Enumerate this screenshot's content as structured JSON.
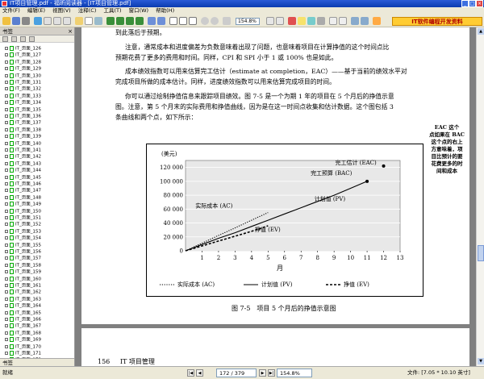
{
  "window": {
    "title": "IT项目管理.pdf - 福昕阅读器 - [IT项目管理.pdf]",
    "minimize": "_",
    "maximize": "□",
    "close": "×"
  },
  "menu": [
    "文件(F)",
    "编辑(E)",
    "视图(V)",
    "注释(C)",
    "工具(T)",
    "窗口(W)",
    "帮助(H)"
  ],
  "toolbar": {
    "zoom_value": "154.8%"
  },
  "ad_banner": "IT软件编程开发资料",
  "sidebar": {
    "title": "书签",
    "close_label": "×",
    "bookmarks": [
      "IT_页面_126",
      "IT_页面_127",
      "IT_页面_128",
      "IT_页面_129",
      "IT_页面_130",
      "IT_页面_131",
      "IT_页面_132",
      "IT_页面_133",
      "IT_页面_134",
      "IT_页面_135",
      "IT_页面_136",
      "IT_页面_137",
      "IT_页面_138",
      "IT_页面_139",
      "IT_页面_140",
      "IT_页面_141",
      "IT_页面_142",
      "IT_页面_143",
      "IT_页面_144",
      "IT_页面_145",
      "IT_页面_146",
      "IT_页面_147",
      "IT_页面_148",
      "IT_页面_149",
      "IT_页面_150",
      "IT_页面_151",
      "IT_页面_152",
      "IT_页面_153",
      "IT_页面_154",
      "IT_页面_155",
      "IT_页面_156",
      "IT_页面_157",
      "IT_页面_158",
      "IT_页面_159",
      "IT_页面_160",
      "IT_页面_161",
      "IT_页面_162",
      "IT_页面_163",
      "IT_页面_164",
      "IT_页面_165",
      "IT_页面_166",
      "IT_页面_167",
      "IT_页面_168",
      "IT_页面_169",
      "IT_页面_170",
      "IT_页面_171",
      "IT_页面_172"
    ],
    "footer": "书签"
  },
  "document": {
    "lines": [
      "到此落后于预期。",
      "注意，通常成本和进度偏差为负数意味着出现了问题，也意味着项目在计算挣值的这个时间点比",
      "预期花费了更多的费用和时间。同样，CPI 和 SPI 小于 1 或 100% 也是如此。",
      "成本绩效指数可以用来估算完工估计（estimate at completion，EAC）——基于当前的绩效水平对",
      "完成项目所做的成本估计。同样，进度绩效指数可以用来估算完成项目的时间。",
      "你可以通过绘制挣值信息来跟踪项目绩效。图 7-5 是一个为期 1 年的项目在 5 个月后的挣值示意",
      "图。注意，第 5 个月末的实际费用和挣值曲线，因为是在这一时间点收集和估计数据。这个图包括 3",
      "条曲线和两个点，如下所示："
    ],
    "caption": "图 7-5　项目 5 个月后的挣值示意图",
    "page_number": "156",
    "page_footer": "IT 项目管理"
  },
  "chart_data": {
    "type": "line",
    "ylabel": "(美元)",
    "xlabel": "月",
    "x": [
      0,
      1,
      2,
      3,
      4,
      5,
      6,
      7,
      8,
      9,
      10,
      11,
      12,
      13
    ],
    "xticks": [
      "1",
      "2",
      "3",
      "4",
      "5",
      "6",
      "7",
      "8",
      "9",
      "10",
      "11",
      "12",
      "13"
    ],
    "yticks": [
      "0",
      "20 000",
      "40 000",
      "60 000",
      "80 000",
      "100 000",
      "120 000"
    ],
    "ylim": [
      0,
      130000
    ],
    "xlim": [
      0,
      13
    ],
    "grid": true,
    "series": [
      {
        "name": "计划值 (PV)",
        "style": "solid",
        "x": [
          0,
          1,
          2,
          3,
          4,
          5,
          6,
          7,
          8,
          9,
          10,
          11
        ],
        "y": [
          0,
          9000,
          18000,
          26000,
          35000,
          44000,
          53000,
          62000,
          71000,
          80000,
          90000,
          100000
        ]
      },
      {
        "name": "实际成本 (AC)",
        "style": "dotted",
        "x": [
          0,
          1,
          2,
          3,
          4,
          5
        ],
        "y": [
          0,
          11000,
          22000,
          33000,
          44000,
          55000
        ]
      },
      {
        "name": "挣值 (EV)",
        "style": "dashed",
        "x": [
          0,
          1,
          2,
          3,
          4,
          5
        ],
        "y": [
          0,
          7000,
          14000,
          21000,
          28000,
          36000
        ]
      }
    ],
    "points": [
      {
        "label": "完工预算 (BAC)",
        "x": 11,
        "y": 100000
      },
      {
        "label": "完工估计 (EAC)",
        "x": 12,
        "y": 122000
      }
    ],
    "series_labels": [
      {
        "text": "实际成本 (AC)",
        "x": 0.6,
        "y": 62000
      },
      {
        "text": "计划值 (PV)",
        "x": 7.8,
        "y": 72000
      },
      {
        "text": "挣值 (EV)",
        "x": 4.2,
        "y": 28000
      }
    ],
    "annotation": [
      "EAC 这个",
      "点如果在 BAC",
      "这个点的右上",
      "方意味着，项",
      "目比预计的要",
      "花费更多的时",
      "间和成本"
    ],
    "legend": [
      {
        "label": "实际成本 (AC)",
        "style": "dotted"
      },
      {
        "label": "计划值 (PV)",
        "style": "solid"
      },
      {
        "label": "挣值 (EV)",
        "style": "dashed"
      }
    ],
    "legend_position": "bottom"
  },
  "status": {
    "ready": "就绪",
    "page": "172 / 379",
    "zoom": "154.8%",
    "doc_size": "文件: [7.05 * 10.10 英寸]"
  }
}
